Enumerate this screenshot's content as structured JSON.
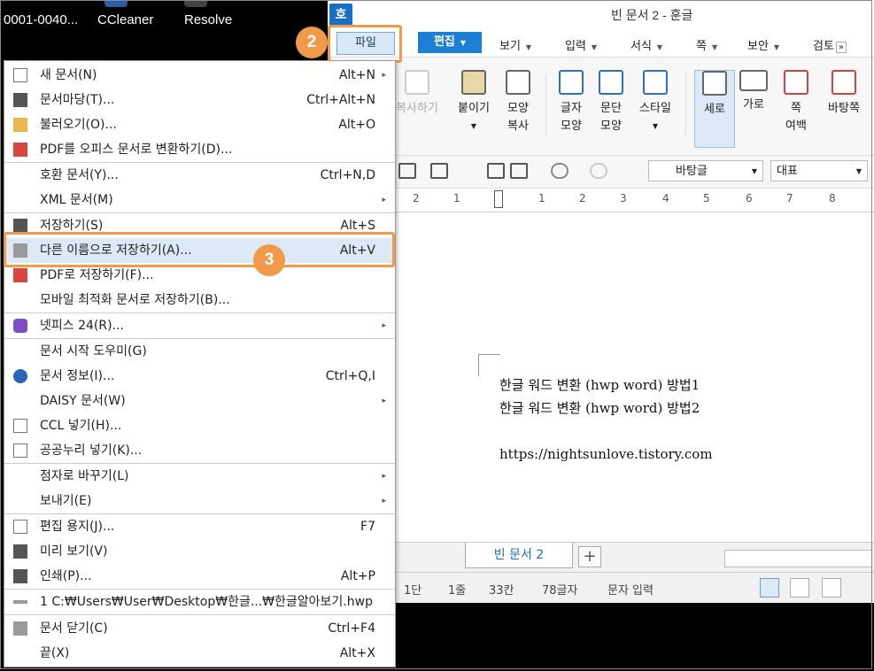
{
  "desktop": {
    "icons": [
      {
        "label": "0001-0040..."
      },
      {
        "label": "CCleaner"
      },
      {
        "label": "Resolve"
      }
    ]
  },
  "app": {
    "logo": "호",
    "title": "빈 문서 2 - 훈글",
    "menu": {
      "file": "파일",
      "edit": "편집",
      "items": [
        "보기",
        "입력",
        "서식",
        "쪽",
        "보안",
        "검토"
      ]
    },
    "ribbon": {
      "buttons": [
        {
          "label": "복사하기"
        },
        {
          "label": "붙이기"
        },
        {
          "label": "모양\n복사"
        },
        {
          "label": "글자\n모양"
        },
        {
          "label": "문단\n모양"
        },
        {
          "label": "스타일"
        },
        {
          "label": "세로"
        },
        {
          "label": "가로"
        },
        {
          "label": "쪽\n여백"
        },
        {
          "label": "바탕쪽"
        }
      ]
    },
    "toolbar": {
      "font": "바탕글",
      "style": "대표"
    },
    "ruler": {
      "numbers": [
        "2",
        "1",
        "1",
        "2",
        "3",
        "4",
        "5",
        "6",
        "7",
        "8"
      ]
    },
    "document": {
      "lines": [
        "한글 워드 변환 (hwp word) 방법1",
        "한글 워드 변환 (hwp word) 방법2",
        "https://nightsunlove.tistory.com"
      ]
    },
    "tabs": {
      "active": "빈 문서 2",
      "add": "+"
    },
    "status": {
      "items": [
        "1단",
        "1줄",
        "33칸",
        "78글자",
        "문자 입력"
      ]
    }
  },
  "file_menu": {
    "items": [
      {
        "label": "새 문서(N)",
        "shortcut": "Alt+N",
        "arrow": "▸"
      },
      {
        "label": "문서마당(T)...",
        "shortcut": "Ctrl+Alt+N"
      },
      {
        "label": "불러오기(O)...",
        "shortcut": "Alt+O"
      },
      {
        "label": "PDF를 오피스 문서로 변환하기(D)..."
      },
      {
        "label": "호환 문서(Y)...",
        "shortcut": "Ctrl+N,D"
      },
      {
        "label": "XML 문서(M)",
        "arrow": "▸"
      },
      {
        "label": "저장하기(S)",
        "shortcut": "Alt+S"
      },
      {
        "label": "다른 이름으로 저장하기(A)...",
        "shortcut": "Alt+V"
      },
      {
        "label": "PDF로 저장하기(F)..."
      },
      {
        "label": "모바일 최적화 문서로 저장하기(B)..."
      },
      {
        "label": "넷피스 24(R)...",
        "arrow": "▸"
      },
      {
        "label": "문서 시작 도우미(G)"
      },
      {
        "label": "문서 정보(I)...",
        "shortcut": "Ctrl+Q,I"
      },
      {
        "label": "DAISY 문서(W)",
        "arrow": "▸"
      },
      {
        "label": "CCL 넣기(H)..."
      },
      {
        "label": "공공누리 넣기(K)..."
      },
      {
        "label": "점자로 바꾸기(L)",
        "arrow": "▸"
      },
      {
        "label": "보내기(E)",
        "arrow": "▸"
      },
      {
        "label": "편집 용지(J)...",
        "shortcut": "F7"
      },
      {
        "label": "미리 보기(V)"
      },
      {
        "label": "인쇄(P)...",
        "shortcut": "Alt+P"
      },
      {
        "label": "1 C:₩Users₩User₩Desktop₩한글...₩한글알아보기.hwp"
      },
      {
        "label": "문서 닫기(C)",
        "shortcut": "Ctrl+F4"
      },
      {
        "label": "끝(X)",
        "shortcut": "Alt+X"
      }
    ]
  },
  "steps": {
    "two": "2",
    "three": "3"
  },
  "colors": {
    "highlight": "#f09a4a",
    "accent": "#1c7fd3"
  }
}
